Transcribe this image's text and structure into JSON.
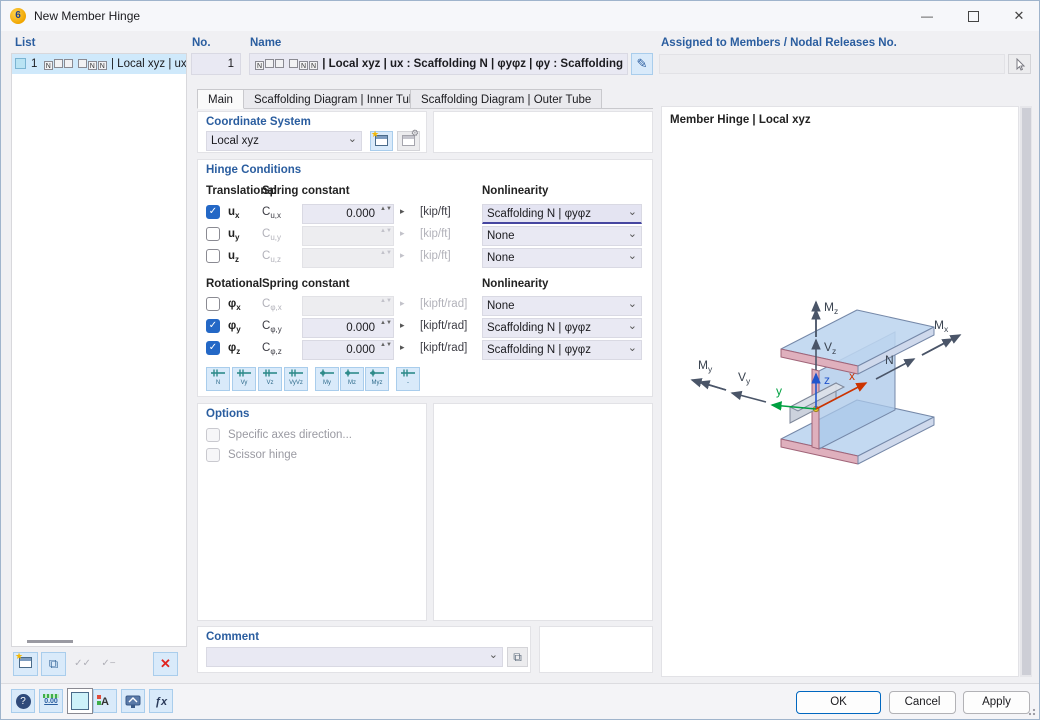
{
  "window": {
    "title": "New Member Hinge",
    "badge": "6",
    "min_glyph": "—",
    "close_glyph": "✕"
  },
  "icons": {
    "chevron_down": "⌄",
    "spin_up": "▲",
    "spin_down": "▼",
    "detail_arrow": "▸",
    "pencil": "✎",
    "star": "★",
    "gear": "⚙",
    "copy": "⧉",
    "check_all": "✓✓",
    "check_partial": "✓−",
    "close_x": "✕",
    "tick": "✓",
    "help": "?",
    "units": "0.00",
    "display_a": "A",
    "fx": "ƒx"
  },
  "list": {
    "header": "List",
    "item": {
      "number": "1",
      "code": [
        "N",
        "",
        "",
        "",
        "N",
        "N"
      ],
      "text": "| Local xyz | ux : Scaffolding N | φyφz | φy : Scaffolding N | φyφz | φz :"
    }
  },
  "no_box": {
    "label": "No.",
    "value": "1"
  },
  "name_box": {
    "label": "Name",
    "code": [
      "N",
      "",
      "",
      "",
      "N",
      "N"
    ],
    "text": "| Local xyz | ux : Scaffolding N | φyφz | φy : Scaffolding N | φyφz | φz :"
  },
  "assigned_box": {
    "label": "Assigned to Members / Nodal Releases No.",
    "value": ""
  },
  "tabs": {
    "main": "Main",
    "inner": "Scaffolding Diagram | Inner Tube",
    "outer": "Scaffolding Diagram | Outer Tube"
  },
  "coordinate_system": {
    "header": "Coordinate System",
    "value": "Local xyz"
  },
  "hinge": {
    "header": "Hinge Conditions",
    "col_translational": "Translational",
    "col_rotational": "Rotational",
    "col_spring": "Spring constant",
    "col_nonlinearity": "Nonlinearity",
    "rows": {
      "ux": {
        "dof_base": "u",
        "dof_sub": "x",
        "c_base": "C",
        "c_sub": "u,x",
        "value": "0.000",
        "unit": "[kip/ft]",
        "nonlin": "Scaffolding N | φyφz"
      },
      "uy": {
        "dof_base": "u",
        "dof_sub": "y",
        "c_base": "C",
        "c_sub": "u,y",
        "value": "",
        "unit": "[kip/ft]",
        "nonlin": "None"
      },
      "uz": {
        "dof_base": "u",
        "dof_sub": "z",
        "c_base": "C",
        "c_sub": "u,z",
        "value": "",
        "unit": "[kip/ft]",
        "nonlin": "None"
      },
      "phix": {
        "dof_base": "φ",
        "dof_sub": "x",
        "c_base": "C",
        "c_sub": "φ,x",
        "value": "",
        "unit": "[kipft/rad]",
        "nonlin": "None"
      },
      "phiy": {
        "dof_base": "φ",
        "dof_sub": "y",
        "c_base": "C",
        "c_sub": "φ,y",
        "value": "0.000",
        "unit": "[kipft/rad]",
        "nonlin": "Scaffolding N | φyφz"
      },
      "phiz": {
        "dof_base": "φ",
        "dof_sub": "z",
        "c_base": "C",
        "c_sub": "φ,z",
        "value": "0.000",
        "unit": "[kipft/rad]",
        "nonlin": "Scaffolding N | φyφz"
      }
    },
    "quick": [
      "N",
      "Vy",
      "Vz",
      "VyVz",
      "My",
      "Mz",
      "Myz",
      "-"
    ]
  },
  "options": {
    "header": "Options",
    "opt1": "Specific axes direction...",
    "opt2": "Scissor hinge"
  },
  "comment": {
    "header": "Comment",
    "value": ""
  },
  "preview": {
    "header": "Member Hinge | Local xyz",
    "labels": {
      "mz": {
        "b": "M",
        "s": "z"
      },
      "vz": {
        "b": "V",
        "s": "z"
      },
      "z": "z",
      "mx": {
        "b": "M",
        "s": "x"
      },
      "n": {
        "b": "N",
        "s": ""
      },
      "x": "x",
      "my": {
        "b": "M",
        "s": "y"
      },
      "vy": {
        "b": "V",
        "s": "y"
      },
      "y": "y"
    }
  },
  "footer": {
    "ok": "OK",
    "cancel": "Cancel",
    "apply": "Apply"
  },
  "colors": {
    "accent": "#2a5d9f",
    "field": "#e9e9f3",
    "selected_row": "#cfe9fb",
    "checked": "#2468c6",
    "danger": "#e0231f"
  }
}
